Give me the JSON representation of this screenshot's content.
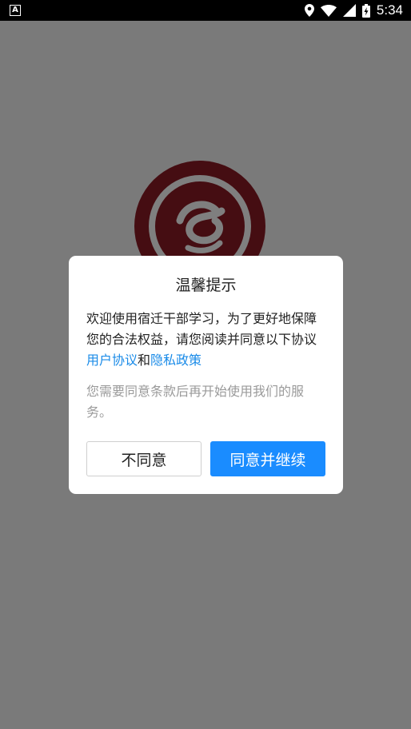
{
  "status_bar": {
    "notification_icon": "A",
    "time": "5:34",
    "icons": [
      "location-icon",
      "wifi-icon",
      "signal-icon",
      "battery-charging-icon"
    ]
  },
  "splash": {
    "logo_icon": "college-seal-logo",
    "logo_color": "#8b1a24"
  },
  "dialog": {
    "title": "温馨提示",
    "body_prefix": "欢迎使用宿迁干部学习，为了更好地保障您的合法权益，请您阅读并同意以下协议",
    "user_agreement_link": "用户协议",
    "conjunction": "和",
    "privacy_policy_link": "隐私政策",
    "note": "您需要同意条款后再开始使用我们的服务。",
    "disagree_label": "不同意",
    "agree_label": "同意并继续",
    "link_color": "#1a8be8",
    "agree_color": "#1a8cff"
  }
}
